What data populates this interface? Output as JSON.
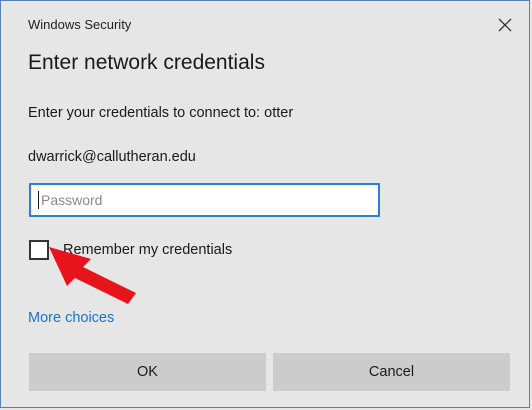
{
  "window": {
    "title": "Windows Security"
  },
  "dialog": {
    "heading": "Enter network credentials",
    "connect_text": "Enter your credentials to connect to: otter",
    "username": "dwarrick@callutheran.edu",
    "password": {
      "placeholder": "Password",
      "value": ""
    },
    "remember": {
      "label": "Remember my credentials",
      "checked": false
    },
    "more_choices": "More choices",
    "buttons": {
      "ok": "OK",
      "cancel": "Cancel"
    }
  },
  "annotation": {
    "arrow_color": "#e8141b"
  },
  "colors": {
    "background": "#e6e6e6",
    "accent": "#2f7fd1",
    "link": "#1a73c7",
    "button": "#cccccc"
  }
}
